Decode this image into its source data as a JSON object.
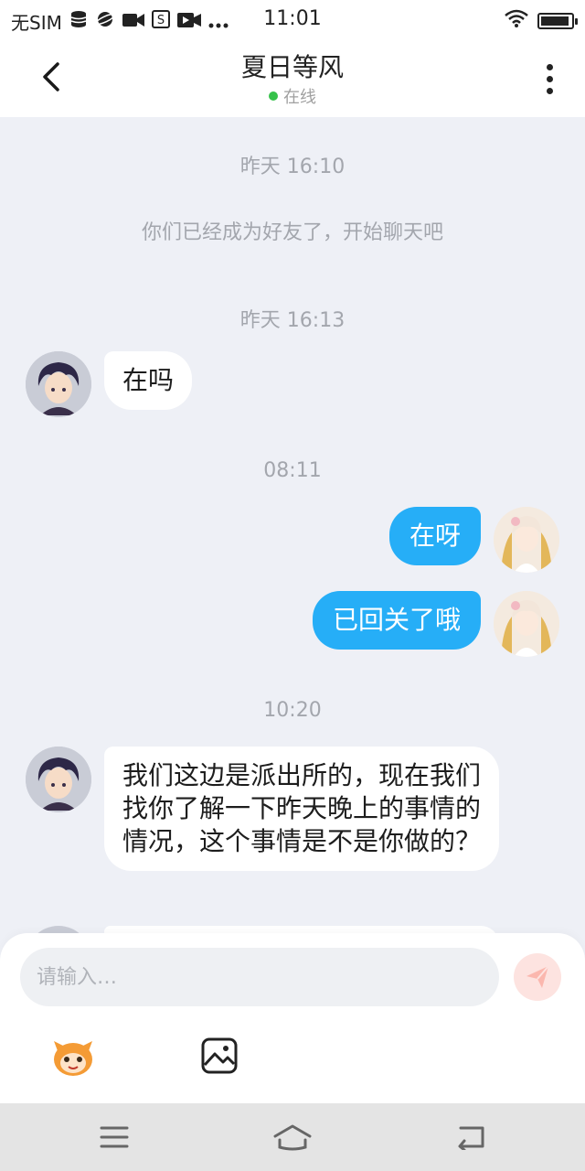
{
  "status_bar": {
    "carrier": "无SIM",
    "time": "11:01",
    "battery_level": 0.95
  },
  "header": {
    "title": "夏日等风",
    "presence": "在线",
    "presence_color": "#36c24a"
  },
  "chat": {
    "timestamps": [
      "昨天 16:10",
      "昨天 16:13",
      "08:11",
      "10:20"
    ],
    "system_message": "你们已经成为好友了，开始聊天吧",
    "messages": [
      {
        "side": "incoming",
        "text": "在吗"
      },
      {
        "side": "outgoing",
        "text": "在呀"
      },
      {
        "side": "outgoing",
        "text": "已回关了哦"
      },
      {
        "side": "incoming",
        "text": "我们这边是派出所的，现在我们找你了解一下昨天晚上的事情的情况，这个事情是不是你做的？"
      }
    ]
  },
  "input": {
    "placeholder": "请输入…"
  },
  "icons": {
    "back": "chevron-left-icon",
    "more": "more-vertical-icon",
    "send": "send-icon",
    "emoji": "mascot-emoji-icon",
    "image": "image-icon",
    "menu": "menu-icon",
    "home": "home-icon",
    "return": "return-icon"
  },
  "colors": {
    "outgoing_bubble": "#26aef7",
    "incoming_bubble": "#ffffff",
    "chat_background": "#eef0f6",
    "send_button": "#fde3e0"
  }
}
